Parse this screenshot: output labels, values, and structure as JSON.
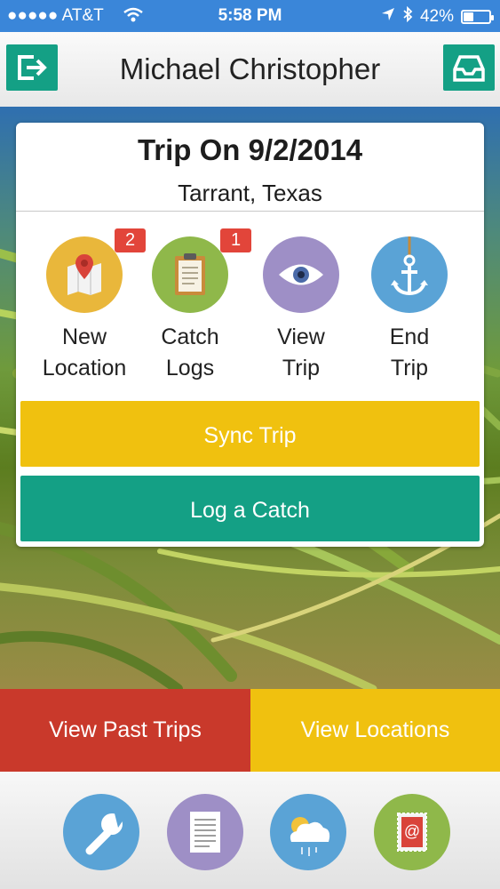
{
  "status_bar": {
    "carrier": "●●●●● AT&T",
    "time": "5:58 PM",
    "battery_percent": "42%",
    "battery_level": 0.42,
    "icons": [
      "wifi-icon",
      "location-arrow-icon",
      "bluetooth-icon",
      "battery-icon"
    ]
  },
  "header": {
    "title": "Michael Christopher",
    "left_button_icon": "logout-icon",
    "right_button_icon": "inbox-tray-icon",
    "accent": "#14a085"
  },
  "trip": {
    "title": "Trip On 9/2/2014",
    "location": "Tarrant, Texas"
  },
  "actions": [
    {
      "label": "New\nLocation",
      "icon": "map-pin-icon",
      "color": "#e9b73b",
      "badge": "2"
    },
    {
      "label": "Catch\nLogs",
      "icon": "clipboard-icon",
      "color": "#8fb84a",
      "badge": "1"
    },
    {
      "label": "View\nTrip",
      "icon": "eye-icon",
      "color": "#9e8fc6",
      "badge": ""
    },
    {
      "label": "End\nTrip",
      "icon": "anchor-icon",
      "color": "#5aa3d6",
      "badge": ""
    }
  ],
  "buttons": {
    "sync": "Sync Trip",
    "log": "Log a Catch"
  },
  "nav": {
    "past_trips": "View Past Trips",
    "locations": "View Locations"
  },
  "dock": [
    {
      "icon": "wrench-icon",
      "color": "#5aa3d6"
    },
    {
      "icon": "document-icon",
      "color": "#9e8fc6"
    },
    {
      "icon": "weather-cloud-icon",
      "color": "#5aa3d6"
    },
    {
      "icon": "email-stamp-icon",
      "color": "#8fb84a"
    }
  ],
  "colors": {
    "yellow": "#f0c10f",
    "teal": "#14a085",
    "red": "#c9392b",
    "badge": "#e2453a"
  }
}
